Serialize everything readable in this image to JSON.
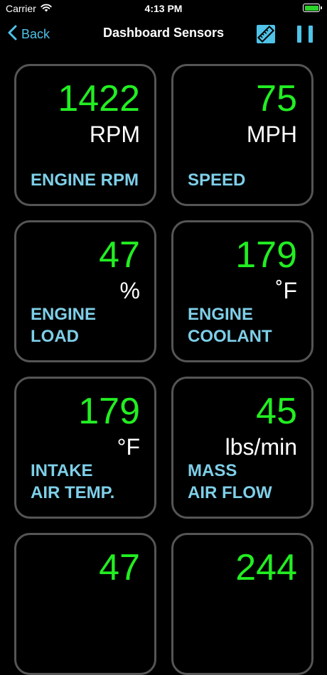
{
  "status_bar": {
    "carrier": "Carrier",
    "time": "4:13 PM",
    "battery_level": 1.0,
    "battery_color": "#2bd42b"
  },
  "nav": {
    "back_label": "Back",
    "title": "Dashboard Sensors",
    "accent_color": "#4fc3e8",
    "icons": [
      "chevron-left-icon",
      "ruler-icon",
      "pause-icon"
    ]
  },
  "tiles": [
    {
      "value": "1422",
      "unit": "RPM",
      "label_lines": [
        "ENGINE RPM"
      ]
    },
    {
      "value": "75",
      "unit": "MPH",
      "label_lines": [
        "SPEED"
      ]
    },
    {
      "value": "47",
      "unit": "%",
      "label_lines": [
        "ENGINE",
        "LOAD"
      ]
    },
    {
      "value": "179",
      "unit": "˚F",
      "label_lines": [
        "ENGINE",
        "COOLANT"
      ]
    },
    {
      "value": "179",
      "unit": "°F",
      "label_lines": [
        "INTAKE",
        "AIR TEMP."
      ]
    },
    {
      "value": "45",
      "unit": "lbs/min",
      "label_lines": [
        "MASS",
        "AIR FLOW"
      ]
    },
    {
      "value": "47",
      "unit": "",
      "label_lines": []
    },
    {
      "value": "244",
      "unit": "",
      "label_lines": []
    }
  ],
  "colors": {
    "value": "#22ee22",
    "label": "#7ecfe8",
    "tile_border": "#555555"
  }
}
